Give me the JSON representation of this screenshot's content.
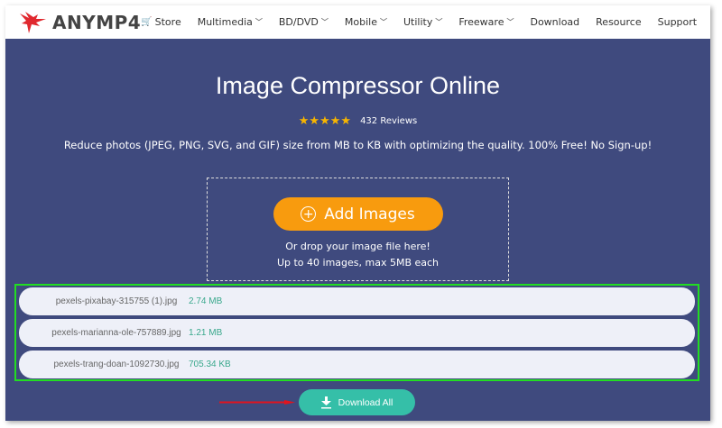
{
  "header": {
    "brand": "ANYMP4",
    "nav": [
      {
        "label": "Store",
        "icon": "cart-icon"
      },
      {
        "label": "Multimedia",
        "dropdown": true
      },
      {
        "label": "BD/DVD",
        "dropdown": true
      },
      {
        "label": "Mobile",
        "dropdown": true
      },
      {
        "label": "Utility",
        "dropdown": true
      },
      {
        "label": "Freeware",
        "dropdown": true
      },
      {
        "label": "Download"
      },
      {
        "label": "Resource"
      },
      {
        "label": "Support"
      }
    ]
  },
  "hero": {
    "title": "Image Compressor Online",
    "stars": "★★★★★",
    "reviews": "432 Reviews",
    "description": "Reduce photos (JPEG, PNG, SVG, and GIF) size from MB to KB with optimizing the quality. 100% Free! No Sign-up!"
  },
  "upload": {
    "button": "Add Images",
    "hint1": "Or drop your image file here!",
    "hint2": "Up to 40 images, max 5MB each"
  },
  "files": [
    {
      "name": "pexels-pixabay-315755 (1).jpg",
      "size": "2.74 MB"
    },
    {
      "name": "pexels-marianna-ole-757889.jpg",
      "size": "1.21 MB"
    },
    {
      "name": "pexels-trang-doan-1092730.jpg",
      "size": "705.34 KB"
    }
  ],
  "download_all": "Download All",
  "colors": {
    "bg": "#3f4a7e",
    "accent": "#f89b0e",
    "download": "#35bfa8",
    "highlight": "#22dd22"
  }
}
